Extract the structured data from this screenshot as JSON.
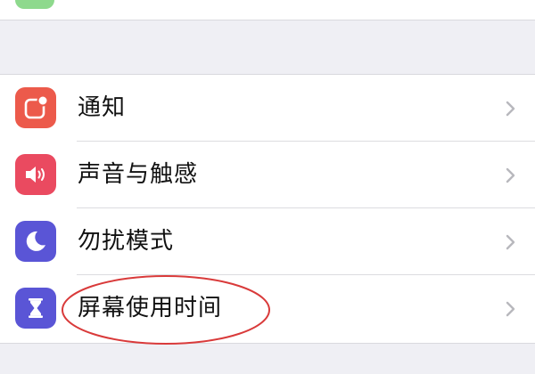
{
  "settings": {
    "items": [
      {
        "label": "通知",
        "icon": "notifications-icon",
        "color": "#ec5a4b"
      },
      {
        "label": "声音与触感",
        "icon": "speaker-icon",
        "color": "#ea4a60"
      },
      {
        "label": "勿扰模式",
        "icon": "moon-icon",
        "color": "#5a55d6"
      },
      {
        "label": "屏幕使用时间",
        "icon": "hourglass-icon",
        "color": "#5a55d6"
      }
    ]
  },
  "colors": {
    "background": "#efeff4",
    "separator": "#dcdce0",
    "chevron": "#b8b8bd",
    "annotation": "#d93a3a",
    "partial_top_icon": "#8ed98d"
  }
}
